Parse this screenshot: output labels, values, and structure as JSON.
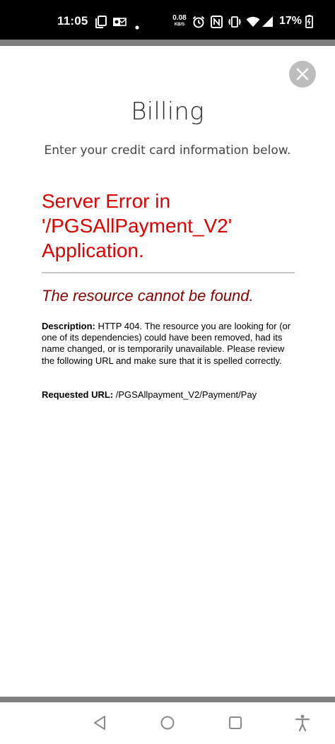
{
  "status_bar": {
    "time": "11:05",
    "network_speed_value": "0.08",
    "network_speed_unit": "KB/S",
    "battery_percent": "17%",
    "icons": [
      "copy-icon",
      "outlook-icon",
      "dot-icon",
      "alarm-icon",
      "nfc-icon",
      "vibrate-icon",
      "wifi-icon",
      "signal-icon",
      "battery-icon"
    ]
  },
  "dialog": {
    "title": "Billing",
    "subtitle": "Enter your credit card information below.",
    "close_icon": "close-icon"
  },
  "error": {
    "heading_line1": "Server Error in",
    "heading_line2": "'/PGSAllPayment_V2'",
    "heading_line3": "Application.",
    "subheading": "The resource cannot be found.",
    "description_label": "Description:",
    "description_text": "HTTP 404. The resource you are looking for (or one of its dependencies) could have been removed, had its name changed, or is temporarily unavailable.  Please review the following URL and make sure that it is spelled correctly.",
    "requested_url_label": "Requested URL:",
    "requested_url_value": "/PGSAllpayment_V2/Payment/Pay"
  },
  "nav_bar": {
    "icons": [
      "back-icon",
      "home-icon",
      "recents-icon",
      "accessibility-icon"
    ]
  },
  "colors": {
    "error_red": "#e00000",
    "error_dark_red": "#8b0000",
    "status_bar_bg": "#000000"
  }
}
